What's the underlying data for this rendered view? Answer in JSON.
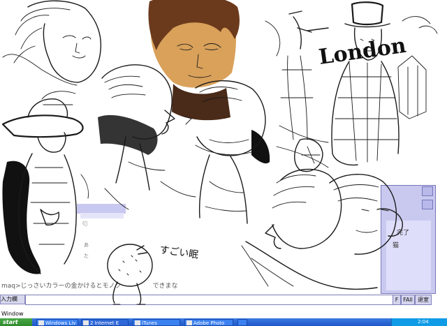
{
  "window": {
    "title_fragment": "Window"
  },
  "chat": {
    "message_fragment": "maq>じっさいカラーの金かけるとモノク　　　　　できまな",
    "input_label": "入力欄",
    "input_value": "",
    "side_items": [
      "完了",
      "猫"
    ],
    "small_marks": [
      "(ﾟ",
      "あ",
      "た"
    ],
    "buttons": {
      "f": "F",
      "fall": "FAll",
      "exit": "退室"
    }
  },
  "sketch": {
    "lettering_1": "London",
    "lettering_2": "すごい眠"
  },
  "taskbar": {
    "start_label": "start",
    "items": [
      "Windows Liv",
      "2 Internet E",
      "iTunes",
      "Adobe Photo",
      ""
    ],
    "clock": "2:04"
  },
  "colors": {
    "skin_tone": "#d9a15a",
    "hair_brown": "#6b3a1c",
    "chat_purple": "#c9c9f0",
    "taskbar_blue": "#2460d4",
    "start_green": "#3c9a38"
  }
}
